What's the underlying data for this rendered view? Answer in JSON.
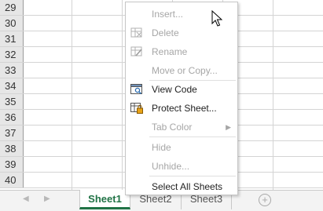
{
  "rows": [
    "29",
    "30",
    "31",
    "32",
    "33",
    "34",
    "35",
    "36",
    "37",
    "38",
    "39",
    "40"
  ],
  "context_menu": {
    "insert": "Insert...",
    "delete": "Delete",
    "rename": "Rename",
    "move_copy": "Move or Copy...",
    "view_code": "View Code",
    "protect_sheet": "Protect Sheet...",
    "tab_color": "Tab Color",
    "hide": "Hide",
    "unhide": "Unhide...",
    "select_all_sheets": "Select All Sheets"
  },
  "sheets": [
    "Sheet1",
    "Sheet2",
    "Sheet3"
  ],
  "active_sheet": "Sheet1",
  "icons": {
    "delete": "delete-sheet-icon",
    "rename": "rename-sheet-icon",
    "view_code": "view-code-icon",
    "protect_sheet": "protect-sheet-icon"
  }
}
